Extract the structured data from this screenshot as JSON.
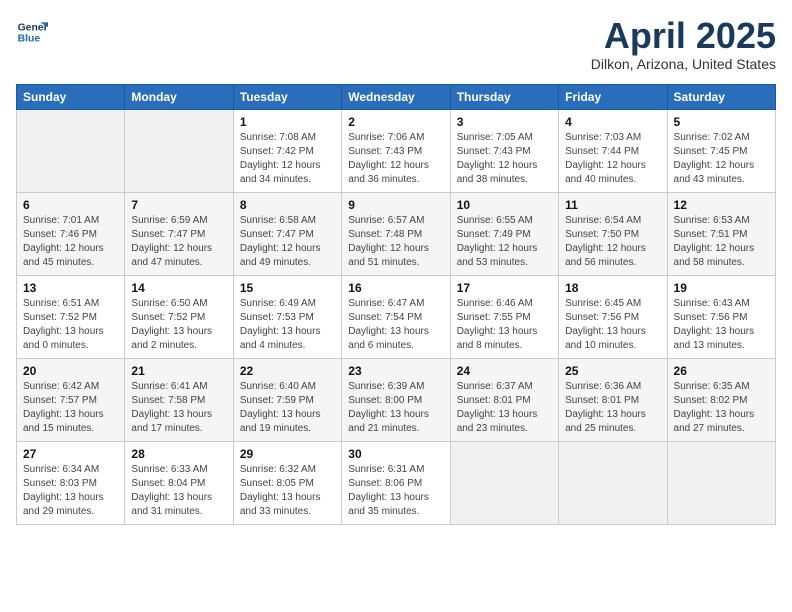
{
  "header": {
    "logo_line1": "General",
    "logo_line2": "Blue",
    "title": "April 2025",
    "subtitle": "Dilkon, Arizona, United States"
  },
  "weekdays": [
    "Sunday",
    "Monday",
    "Tuesday",
    "Wednesday",
    "Thursday",
    "Friday",
    "Saturday"
  ],
  "weeks": [
    [
      {
        "day": "",
        "info": ""
      },
      {
        "day": "",
        "info": ""
      },
      {
        "day": "1",
        "info": "Sunrise: 7:08 AM\nSunset: 7:42 PM\nDaylight: 12 hours and 34 minutes."
      },
      {
        "day": "2",
        "info": "Sunrise: 7:06 AM\nSunset: 7:43 PM\nDaylight: 12 hours and 36 minutes."
      },
      {
        "day": "3",
        "info": "Sunrise: 7:05 AM\nSunset: 7:43 PM\nDaylight: 12 hours and 38 minutes."
      },
      {
        "day": "4",
        "info": "Sunrise: 7:03 AM\nSunset: 7:44 PM\nDaylight: 12 hours and 40 minutes."
      },
      {
        "day": "5",
        "info": "Sunrise: 7:02 AM\nSunset: 7:45 PM\nDaylight: 12 hours and 43 minutes."
      }
    ],
    [
      {
        "day": "6",
        "info": "Sunrise: 7:01 AM\nSunset: 7:46 PM\nDaylight: 12 hours and 45 minutes."
      },
      {
        "day": "7",
        "info": "Sunrise: 6:59 AM\nSunset: 7:47 PM\nDaylight: 12 hours and 47 minutes."
      },
      {
        "day": "8",
        "info": "Sunrise: 6:58 AM\nSunset: 7:47 PM\nDaylight: 12 hours and 49 minutes."
      },
      {
        "day": "9",
        "info": "Sunrise: 6:57 AM\nSunset: 7:48 PM\nDaylight: 12 hours and 51 minutes."
      },
      {
        "day": "10",
        "info": "Sunrise: 6:55 AM\nSunset: 7:49 PM\nDaylight: 12 hours and 53 minutes."
      },
      {
        "day": "11",
        "info": "Sunrise: 6:54 AM\nSunset: 7:50 PM\nDaylight: 12 hours and 56 minutes."
      },
      {
        "day": "12",
        "info": "Sunrise: 6:53 AM\nSunset: 7:51 PM\nDaylight: 12 hours and 58 minutes."
      }
    ],
    [
      {
        "day": "13",
        "info": "Sunrise: 6:51 AM\nSunset: 7:52 PM\nDaylight: 13 hours and 0 minutes."
      },
      {
        "day": "14",
        "info": "Sunrise: 6:50 AM\nSunset: 7:52 PM\nDaylight: 13 hours and 2 minutes."
      },
      {
        "day": "15",
        "info": "Sunrise: 6:49 AM\nSunset: 7:53 PM\nDaylight: 13 hours and 4 minutes."
      },
      {
        "day": "16",
        "info": "Sunrise: 6:47 AM\nSunset: 7:54 PM\nDaylight: 13 hours and 6 minutes."
      },
      {
        "day": "17",
        "info": "Sunrise: 6:46 AM\nSunset: 7:55 PM\nDaylight: 13 hours and 8 minutes."
      },
      {
        "day": "18",
        "info": "Sunrise: 6:45 AM\nSunset: 7:56 PM\nDaylight: 13 hours and 10 minutes."
      },
      {
        "day": "19",
        "info": "Sunrise: 6:43 AM\nSunset: 7:56 PM\nDaylight: 13 hours and 13 minutes."
      }
    ],
    [
      {
        "day": "20",
        "info": "Sunrise: 6:42 AM\nSunset: 7:57 PM\nDaylight: 13 hours and 15 minutes."
      },
      {
        "day": "21",
        "info": "Sunrise: 6:41 AM\nSunset: 7:58 PM\nDaylight: 13 hours and 17 minutes."
      },
      {
        "day": "22",
        "info": "Sunrise: 6:40 AM\nSunset: 7:59 PM\nDaylight: 13 hours and 19 minutes."
      },
      {
        "day": "23",
        "info": "Sunrise: 6:39 AM\nSunset: 8:00 PM\nDaylight: 13 hours and 21 minutes."
      },
      {
        "day": "24",
        "info": "Sunrise: 6:37 AM\nSunset: 8:01 PM\nDaylight: 13 hours and 23 minutes."
      },
      {
        "day": "25",
        "info": "Sunrise: 6:36 AM\nSunset: 8:01 PM\nDaylight: 13 hours and 25 minutes."
      },
      {
        "day": "26",
        "info": "Sunrise: 6:35 AM\nSunset: 8:02 PM\nDaylight: 13 hours and 27 minutes."
      }
    ],
    [
      {
        "day": "27",
        "info": "Sunrise: 6:34 AM\nSunset: 8:03 PM\nDaylight: 13 hours and 29 minutes."
      },
      {
        "day": "28",
        "info": "Sunrise: 6:33 AM\nSunset: 8:04 PM\nDaylight: 13 hours and 31 minutes."
      },
      {
        "day": "29",
        "info": "Sunrise: 6:32 AM\nSunset: 8:05 PM\nDaylight: 13 hours and 33 minutes."
      },
      {
        "day": "30",
        "info": "Sunrise: 6:31 AM\nSunset: 8:06 PM\nDaylight: 13 hours and 35 minutes."
      },
      {
        "day": "",
        "info": ""
      },
      {
        "day": "",
        "info": ""
      },
      {
        "day": "",
        "info": ""
      }
    ]
  ]
}
